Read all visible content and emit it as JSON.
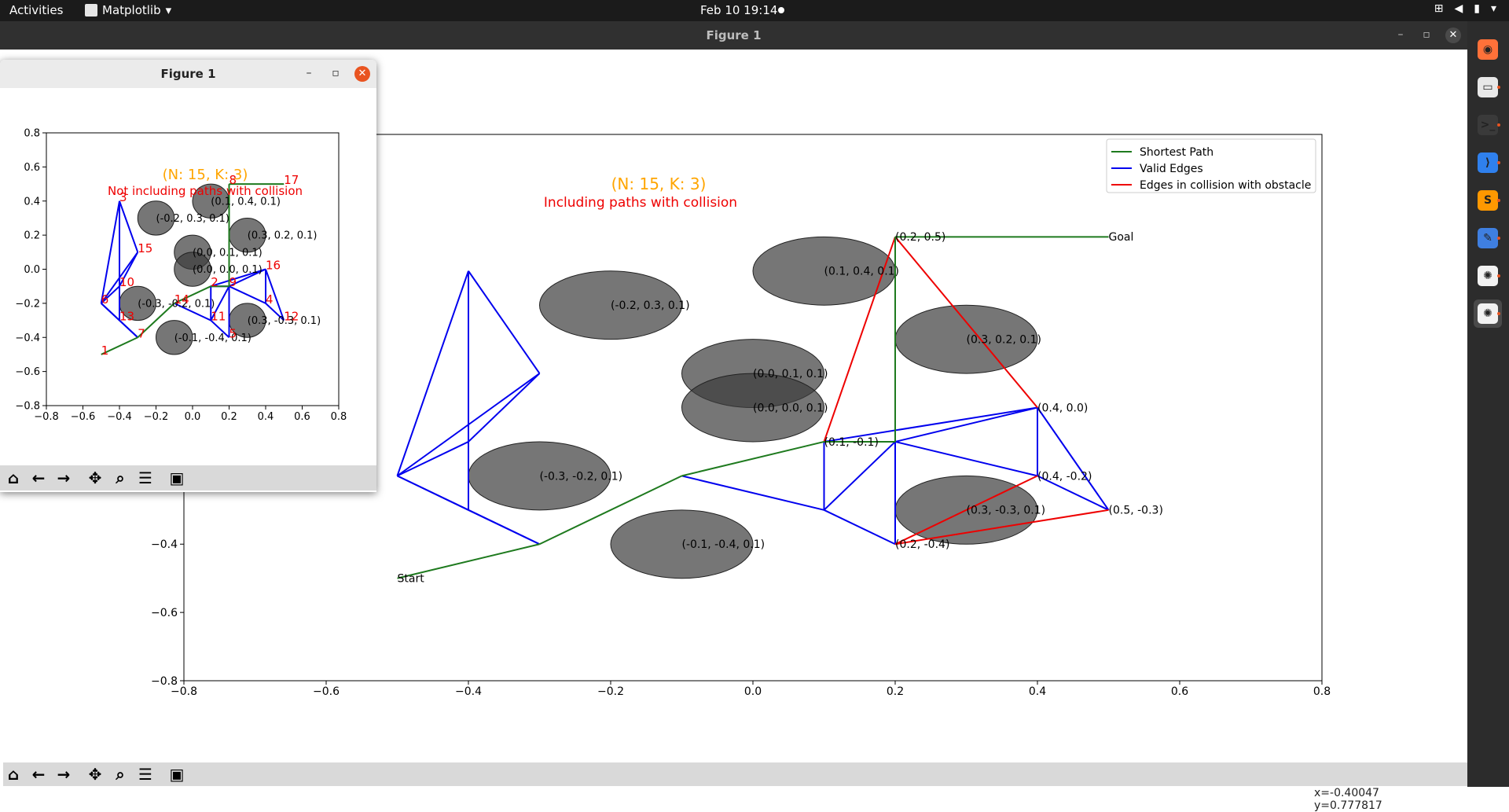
{
  "topbar": {
    "activities": "Activities",
    "app_menu": "Matplotlib",
    "clock": "Feb 10  19:14"
  },
  "main_window": {
    "title": "Figure 1",
    "coords": {
      "x": "x=-0.40047",
      "y": "y=0.777817"
    }
  },
  "small_window": {
    "title": "Figure 1"
  },
  "toolbar_icons": [
    "home-icon",
    "back-icon",
    "forward-icon",
    "pan-icon",
    "zoom-icon",
    "configure-icon",
    "save-icon"
  ],
  "dock_icons": [
    "firefox-icon",
    "files-icon",
    "terminal-icon",
    "vscode-icon",
    "sublime-icon",
    "text-editor-icon",
    "matplotlib-icon",
    "matplotlib-icon"
  ],
  "colors": {
    "shortest": "#1e7a1e",
    "valid": "#0000ee",
    "collision": "#ee0000",
    "orange": "#ffa500",
    "obstacle": "#3c3c3c"
  },
  "chart_data": [
    {
      "type": "scatter",
      "title": "(N: 15, K: 3)",
      "subtitle": "Including paths with collision",
      "xlim": [
        -0.8,
        0.8
      ],
      "ylim": [
        -0.8,
        0.8
      ],
      "xticks": [
        "−0.8",
        "−0.6",
        "−0.4",
        "−0.2",
        "0.0",
        "0.2",
        "0.4",
        "0.6",
        "0.8"
      ],
      "yticks": [
        "−0.8",
        "−0.6",
        "−0.4"
      ],
      "legend": {
        "placement": "top-right",
        "entries": [
          "Shortest Path",
          "Valid Edges",
          "Edges in collision with obstacle"
        ]
      },
      "obstacles": [
        {
          "x": 0.1,
          "y": 0.4,
          "r": 0.1,
          "label": "(0.1, 0.4, 0.1)"
        },
        {
          "x": -0.2,
          "y": 0.3,
          "r": 0.1,
          "label": "(-0.2, 0.3, 0.1)"
        },
        {
          "x": 0.3,
          "y": 0.2,
          "r": 0.1,
          "label": "(0.3, 0.2, 0.1)"
        },
        {
          "x": 0.0,
          "y": 0.1,
          "r": 0.1,
          "label": "(0.0, 0.1, 0.1)"
        },
        {
          "x": 0.0,
          "y": 0.0,
          "r": 0.1,
          "label": "(0.0, 0.0, 0.1)"
        },
        {
          "x": -0.3,
          "y": -0.2,
          "r": 0.1,
          "label": "(-0.3, -0.2, 0.1)"
        },
        {
          "x": 0.3,
          "y": -0.3,
          "r": 0.1,
          "label": "(0.3, -0.3, 0.1)"
        },
        {
          "x": -0.1,
          "y": -0.4,
          "r": 0.1,
          "label": "(-0.1, -0.4, 0.1)"
        }
      ],
      "point_labels": [
        {
          "x": 0.2,
          "y": 0.5,
          "label": "(0.2, 0.5)"
        },
        {
          "x": 0.5,
          "y": 0.5,
          "label": "Goal"
        },
        {
          "x": 0.4,
          "y": 0.0,
          "label": "(0.4, 0.0)"
        },
        {
          "x": 0.1,
          "y": -0.1,
          "label": "(0.1, -0.1)"
        },
        {
          "x": 0.4,
          "y": -0.2,
          "label": "(0.4, -0.2)"
        },
        {
          "x": 0.5,
          "y": -0.3,
          "label": "(0.5, -0.3)"
        },
        {
          "x": 0.2,
          "y": -0.4,
          "label": "(0.2, -0.4)"
        },
        {
          "x": -0.5,
          "y": -0.5,
          "label": "Start"
        }
      ],
      "valid_edges": [
        [
          [
            -0.5,
            -0.2
          ],
          [
            -0.4,
            0.4
          ]
        ],
        [
          [
            -0.4,
            0.4
          ],
          [
            -0.3,
            0.1
          ]
        ],
        [
          [
            -0.3,
            0.1
          ],
          [
            -0.5,
            -0.2
          ]
        ],
        [
          [
            -0.4,
            0.4
          ],
          [
            -0.4,
            -0.3
          ]
        ],
        [
          [
            -0.5,
            -0.2
          ],
          [
            -0.4,
            -0.1
          ]
        ],
        [
          [
            -0.4,
            -0.1
          ],
          [
            -0.3,
            0.1
          ]
        ],
        [
          [
            -0.5,
            -0.2
          ],
          [
            -0.4,
            -0.3
          ]
        ],
        [
          [
            -0.4,
            -0.3
          ],
          [
            -0.3,
            -0.4
          ]
        ],
        [
          [
            -0.5,
            -0.2
          ],
          [
            -0.3,
            -0.4
          ]
        ],
        [
          [
            -0.1,
            -0.2
          ],
          [
            0.1,
            -0.3
          ]
        ],
        [
          [
            0.1,
            -0.3
          ],
          [
            0.1,
            -0.1
          ]
        ],
        [
          [
            0.1,
            -0.3
          ],
          [
            0.2,
            -0.1
          ]
        ],
        [
          [
            0.1,
            -0.3
          ],
          [
            0.2,
            -0.4
          ]
        ],
        [
          [
            0.2,
            -0.4
          ],
          [
            0.2,
            -0.1
          ]
        ],
        [
          [
            0.2,
            -0.1
          ],
          [
            0.4,
            0.0
          ]
        ],
        [
          [
            0.1,
            -0.1
          ],
          [
            0.4,
            0.0
          ]
        ],
        [
          [
            0.2,
            -0.1
          ],
          [
            0.4,
            -0.2
          ]
        ],
        [
          [
            0.4,
            0.0
          ],
          [
            0.4,
            -0.2
          ]
        ],
        [
          [
            0.4,
            -0.2
          ],
          [
            0.5,
            -0.3
          ]
        ],
        [
          [
            0.4,
            0.0
          ],
          [
            0.5,
            -0.3
          ]
        ],
        [
          [
            0.1,
            -0.1
          ],
          [
            0.2,
            -0.1
          ]
        ]
      ],
      "collision_edges": [
        [
          [
            0.1,
            -0.1
          ],
          [
            0.2,
            0.5
          ]
        ],
        [
          [
            0.2,
            0.5
          ],
          [
            0.4,
            0.0
          ]
        ],
        [
          [
            0.2,
            -0.4
          ],
          [
            0.4,
            -0.2
          ]
        ],
        [
          [
            0.2,
            -0.4
          ],
          [
            0.5,
            -0.3
          ]
        ]
      ],
      "shortest_path": [
        [
          -0.5,
          -0.5
        ],
        [
          -0.3,
          -0.4
        ],
        [
          -0.1,
          -0.2
        ],
        [
          0.1,
          -0.1
        ],
        [
          0.2,
          -0.1
        ],
        [
          0.2,
          0.5
        ],
        [
          0.5,
          0.5
        ]
      ]
    },
    {
      "type": "scatter",
      "title": "(N: 15, K: 3)",
      "subtitle": "Not including paths with collision",
      "xlim": [
        -0.8,
        0.8
      ],
      "ylim": [
        -0.8,
        0.8
      ],
      "xticks": [
        "−0.8",
        "−0.6",
        "−0.4",
        "−0.2",
        "0.0",
        "0.2",
        "0.4",
        "0.6",
        "0.8"
      ],
      "yticks": [
        "−0.8",
        "−0.6",
        "−0.4",
        "−0.2",
        "0.0",
        "0.2",
        "0.4",
        "0.6",
        "0.8"
      ],
      "obstacles": [
        {
          "x": 0.1,
          "y": 0.4,
          "r": 0.1,
          "label": "(0.1, 0.4, 0.1)"
        },
        {
          "x": -0.2,
          "y": 0.3,
          "r": 0.1,
          "label": "(-0.2, 0.3, 0.1)"
        },
        {
          "x": 0.3,
          "y": 0.2,
          "r": 0.1,
          "label": "(0.3, 0.2, 0.1)"
        },
        {
          "x": 0.0,
          "y": 0.1,
          "r": 0.1,
          "label": "(0.0, 0.1, 0.1)"
        },
        {
          "x": 0.0,
          "y": 0.0,
          "r": 0.1,
          "label": "(0.0, 0.0, 0.1)"
        },
        {
          "x": -0.3,
          "y": -0.2,
          "r": 0.1,
          "label": "(-0.3, -0.2, 0.1)"
        },
        {
          "x": 0.3,
          "y": -0.3,
          "r": 0.1,
          "label": "(0.3, -0.3, 0.1)"
        },
        {
          "x": -0.1,
          "y": -0.4,
          "r": 0.1,
          "label": "(-0.1, -0.4, 0.1)"
        }
      ],
      "node_labels": [
        {
          "x": -0.5,
          "y": -0.5,
          "label": "1"
        },
        {
          "x": 0.1,
          "y": -0.1,
          "label": "2"
        },
        {
          "x": -0.4,
          "y": 0.4,
          "label": "3"
        },
        {
          "x": 0.4,
          "y": -0.2,
          "label": "4"
        },
        {
          "x": 0.2,
          "y": -0.4,
          "label": "5"
        },
        {
          "x": -0.5,
          "y": -0.2,
          "label": "6"
        },
        {
          "x": -0.3,
          "y": -0.4,
          "label": "7"
        },
        {
          "x": 0.2,
          "y": 0.5,
          "label": "8"
        },
        {
          "x": 0.2,
          "y": -0.1,
          "label": "9"
        },
        {
          "x": -0.4,
          "y": -0.1,
          "label": "10"
        },
        {
          "x": 0.1,
          "y": -0.3,
          "label": "11"
        },
        {
          "x": 0.5,
          "y": -0.3,
          "label": "12"
        },
        {
          "x": -0.4,
          "y": -0.3,
          "label": "13"
        },
        {
          "x": -0.1,
          "y": -0.2,
          "label": "14"
        },
        {
          "x": -0.3,
          "y": 0.1,
          "label": "15"
        },
        {
          "x": 0.4,
          "y": 0.0,
          "label": "16"
        },
        {
          "x": 0.5,
          "y": 0.5,
          "label": "17"
        }
      ],
      "valid_edges": [
        [
          [
            -0.5,
            -0.2
          ],
          [
            -0.4,
            0.4
          ]
        ],
        [
          [
            -0.4,
            0.4
          ],
          [
            -0.3,
            0.1
          ]
        ],
        [
          [
            -0.3,
            0.1
          ],
          [
            -0.5,
            -0.2
          ]
        ],
        [
          [
            -0.4,
            0.4
          ],
          [
            -0.4,
            -0.3
          ]
        ],
        [
          [
            -0.5,
            -0.2
          ],
          [
            -0.4,
            -0.1
          ]
        ],
        [
          [
            -0.4,
            -0.1
          ],
          [
            -0.3,
            0.1
          ]
        ],
        [
          [
            -0.5,
            -0.2
          ],
          [
            -0.4,
            -0.3
          ]
        ],
        [
          [
            -0.4,
            -0.3
          ],
          [
            -0.3,
            -0.4
          ]
        ],
        [
          [
            -0.5,
            -0.2
          ],
          [
            -0.3,
            -0.4
          ]
        ],
        [
          [
            -0.1,
            -0.2
          ],
          [
            0.1,
            -0.3
          ]
        ],
        [
          [
            0.1,
            -0.3
          ],
          [
            0.1,
            -0.1
          ]
        ],
        [
          [
            0.1,
            -0.3
          ],
          [
            0.2,
            -0.1
          ]
        ],
        [
          [
            0.1,
            -0.3
          ],
          [
            0.2,
            -0.4
          ]
        ],
        [
          [
            0.2,
            -0.4
          ],
          [
            0.2,
            -0.1
          ]
        ],
        [
          [
            0.2,
            -0.1
          ],
          [
            0.4,
            0.0
          ]
        ],
        [
          [
            0.1,
            -0.1
          ],
          [
            0.4,
            0.0
          ]
        ],
        [
          [
            0.2,
            -0.1
          ],
          [
            0.4,
            -0.2
          ]
        ],
        [
          [
            0.4,
            0.0
          ],
          [
            0.4,
            -0.2
          ]
        ],
        [
          [
            0.4,
            -0.2
          ],
          [
            0.5,
            -0.3
          ]
        ],
        [
          [
            0.4,
            0.0
          ],
          [
            0.5,
            -0.3
          ]
        ],
        [
          [
            0.1,
            -0.1
          ],
          [
            0.2,
            -0.1
          ]
        ]
      ],
      "shortest_path": [
        [
          -0.5,
          -0.5
        ],
        [
          -0.3,
          -0.4
        ],
        [
          -0.1,
          -0.2
        ],
        [
          0.1,
          -0.1
        ],
        [
          0.2,
          -0.1
        ],
        [
          0.2,
          0.5
        ],
        [
          0.5,
          0.5
        ]
      ]
    }
  ]
}
